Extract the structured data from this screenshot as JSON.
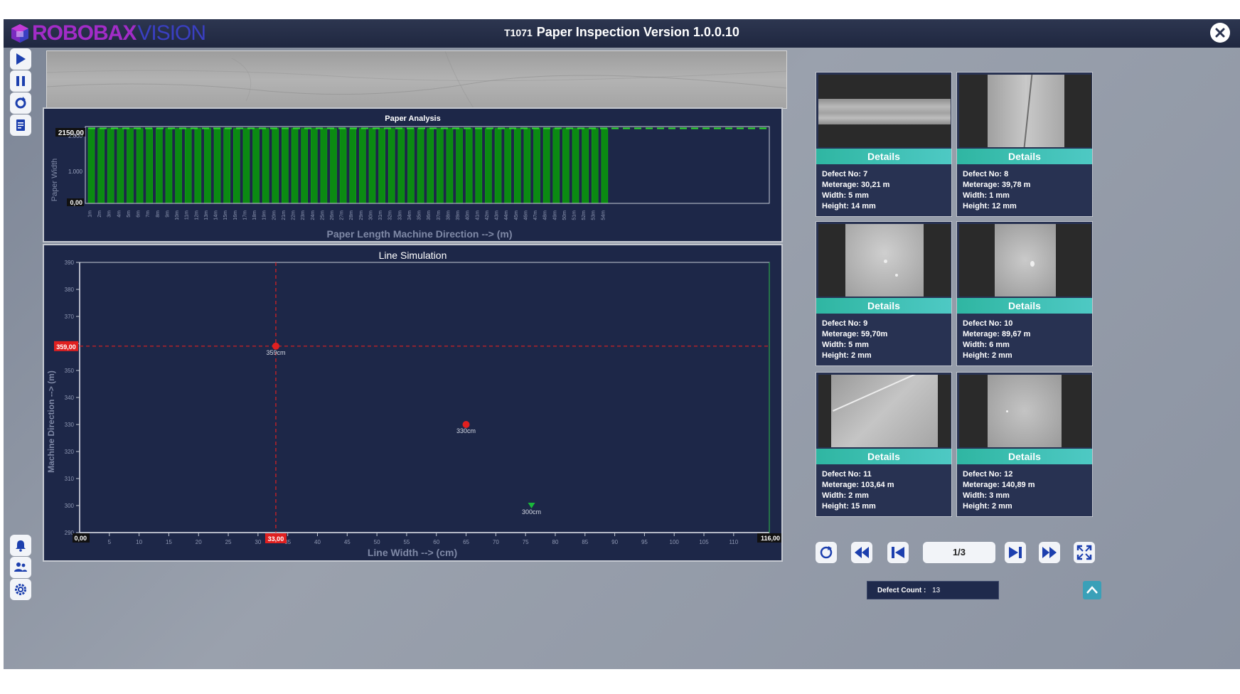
{
  "app": {
    "brand_part1": "ROBOBAX",
    "brand_part2": "VISION",
    "title_code": "T1071",
    "title": "Paper Inspection Version 1.0.0.10",
    "colors": {
      "accent_teal": "#3ec0b8",
      "bar_green": "#0a8f0a",
      "marker_red": "#e02020",
      "marker_green": "#19b83a",
      "panel_bg": "#1d2748"
    }
  },
  "toolbar": {
    "top": [
      "play-icon",
      "pause-icon",
      "refresh-icon",
      "report-icon"
    ],
    "bottom": [
      "alarm-icon",
      "users-icon",
      "settings-icon"
    ]
  },
  "paper_analysis": {
    "title": "Paper Analysis",
    "ylabel": "Paper Width",
    "xlabel": "Paper Length Machine Direction --> (m)",
    "current_value_label": "2150,00",
    "zero_label": "0,00",
    "ytick_mid": "1.000",
    "ytick_top": "2.000"
  },
  "line_simulation": {
    "title": "Line Simulation",
    "ylabel": "Machine Direction --> (m)",
    "xlabel": "Line Width --> (cm)",
    "cursor_y_label": "359,00",
    "cursor_x_label": "33,00",
    "origin_label": "0,00",
    "xmax_label": "116,00"
  },
  "chart_data": [
    {
      "type": "bar",
      "title": "Paper Analysis",
      "xlabel": "Paper Length Machine Direction --> (m)",
      "ylabel": "Paper Width",
      "categories": [
        "1m",
        "2m",
        "3m",
        "4m",
        "5m",
        "6m",
        "7m",
        "8m",
        "9m",
        "10m",
        "11m",
        "12m",
        "13m",
        "14m",
        "15m",
        "16m",
        "17m",
        "18m",
        "19m",
        "20m",
        "21m",
        "22m",
        "23m",
        "24m",
        "25m",
        "26m",
        "27m",
        "28m",
        "29m",
        "30m",
        "31m",
        "32m",
        "33m",
        "34m",
        "35m",
        "36m",
        "37m",
        "38m",
        "39m",
        "40m",
        "41m",
        "42m",
        "43m",
        "44m",
        "45m",
        "46m",
        "47m",
        "48m",
        "49m",
        "50m",
        "51m",
        "52m",
        "53m",
        "54m"
      ],
      "values": [
        2150,
        2150,
        2150,
        2150,
        2150,
        2150,
        2150,
        2150,
        2150,
        2150,
        2150,
        2150,
        2150,
        2150,
        2150,
        2150,
        2150,
        2150,
        2150,
        2150,
        2150,
        2150,
        2150,
        2150,
        2150,
        2150,
        2150,
        2150,
        2150,
        2150,
        2150,
        2150,
        2150,
        2150,
        2150,
        2150,
        2150,
        2150,
        2150,
        2150,
        2150,
        2150,
        2150,
        2150,
        2150,
        2150,
        2150,
        2150,
        2150,
        2150,
        2150,
        2150,
        2150,
        2150
      ],
      "reference_line": 2150,
      "ylim": [
        0,
        2200
      ],
      "yticks": [
        "0,00",
        "1.000",
        "2.000"
      ],
      "grid": false
    },
    {
      "type": "scatter",
      "title": "Line Simulation",
      "xlabel": "Line Width --> (cm)",
      "ylabel": "Machine Direction --> (m)",
      "xlim": [
        0,
        116
      ],
      "ylim": [
        290,
        390
      ],
      "xticks": [
        5,
        10,
        15,
        20,
        25,
        30,
        35,
        40,
        45,
        50,
        55,
        60,
        65,
        70,
        75,
        80,
        85,
        90,
        95,
        100,
        105,
        110
      ],
      "yticks": [
        290,
        300,
        310,
        320,
        330,
        340,
        350,
        360,
        370,
        380,
        390
      ],
      "points": [
        {
          "x": 33,
          "y": 359,
          "label": "359cm",
          "marker": "circle",
          "color": "#e02020"
        },
        {
          "x": 65,
          "y": 330,
          "label": "330cm",
          "marker": "circle",
          "color": "#e02020"
        },
        {
          "x": 76,
          "y": 300,
          "label": "300cm",
          "marker": "triangle-down",
          "color": "#19b83a"
        }
      ],
      "cursor": {
        "x": 33,
        "y": 359
      }
    }
  ],
  "defects": [
    {
      "button": "Details",
      "no_label": "Defect No:",
      "no": "7",
      "meterage_label": "Meterage:",
      "meterage": "30,21 m",
      "width_label": "Width:",
      "width": "5 mm",
      "height_label": "Height:",
      "height": "14 mm",
      "thumb": "horizontal-seam"
    },
    {
      "button": "Details",
      "no_label": "Defect No:",
      "no": "8",
      "meterage_label": "Meterage:",
      "meterage": "39,78 m",
      "width_label": "Width:",
      "width": "1 mm",
      "height_label": "Height:",
      "height": "12 mm",
      "thumb": "vertical-line"
    },
    {
      "button": "Details",
      "no_label": "Defect No:",
      "no": "9",
      "meterage_label": "Meterage:",
      "meterage": "59,70m",
      "width_label": "Width:",
      "width": "5 mm",
      "height_label": "Height:",
      "height": "2 mm",
      "thumb": "spots"
    },
    {
      "button": "Details",
      "no_label": "Defect No:",
      "no": "10",
      "meterage_label": "Meterage:",
      "meterage": "89,67 m",
      "width_label": "Width:",
      "width": "6 mm",
      "height_label": "Height:",
      "height": "2 mm",
      "thumb": "spots-small"
    },
    {
      "button": "Details",
      "no_label": "Defect No:",
      "no": "11",
      "meterage_label": "Meterage:",
      "meterage": "103,64 m",
      "width_label": "Width:",
      "width": "2 mm",
      "height_label": "Height:",
      "height": "15 mm",
      "thumb": "scratch"
    },
    {
      "button": "Details",
      "no_label": "Defect No:",
      "no": "12",
      "meterage_label": "Meterage:",
      "meterage": "140,89 m",
      "width_label": "Width:",
      "width": "3 mm",
      "height_label": "Height:",
      "height": "2 mm",
      "thumb": "dot"
    }
  ],
  "pager": {
    "page": "1/3",
    "defect_count_label": "Defect Count :",
    "defect_count": "13"
  }
}
